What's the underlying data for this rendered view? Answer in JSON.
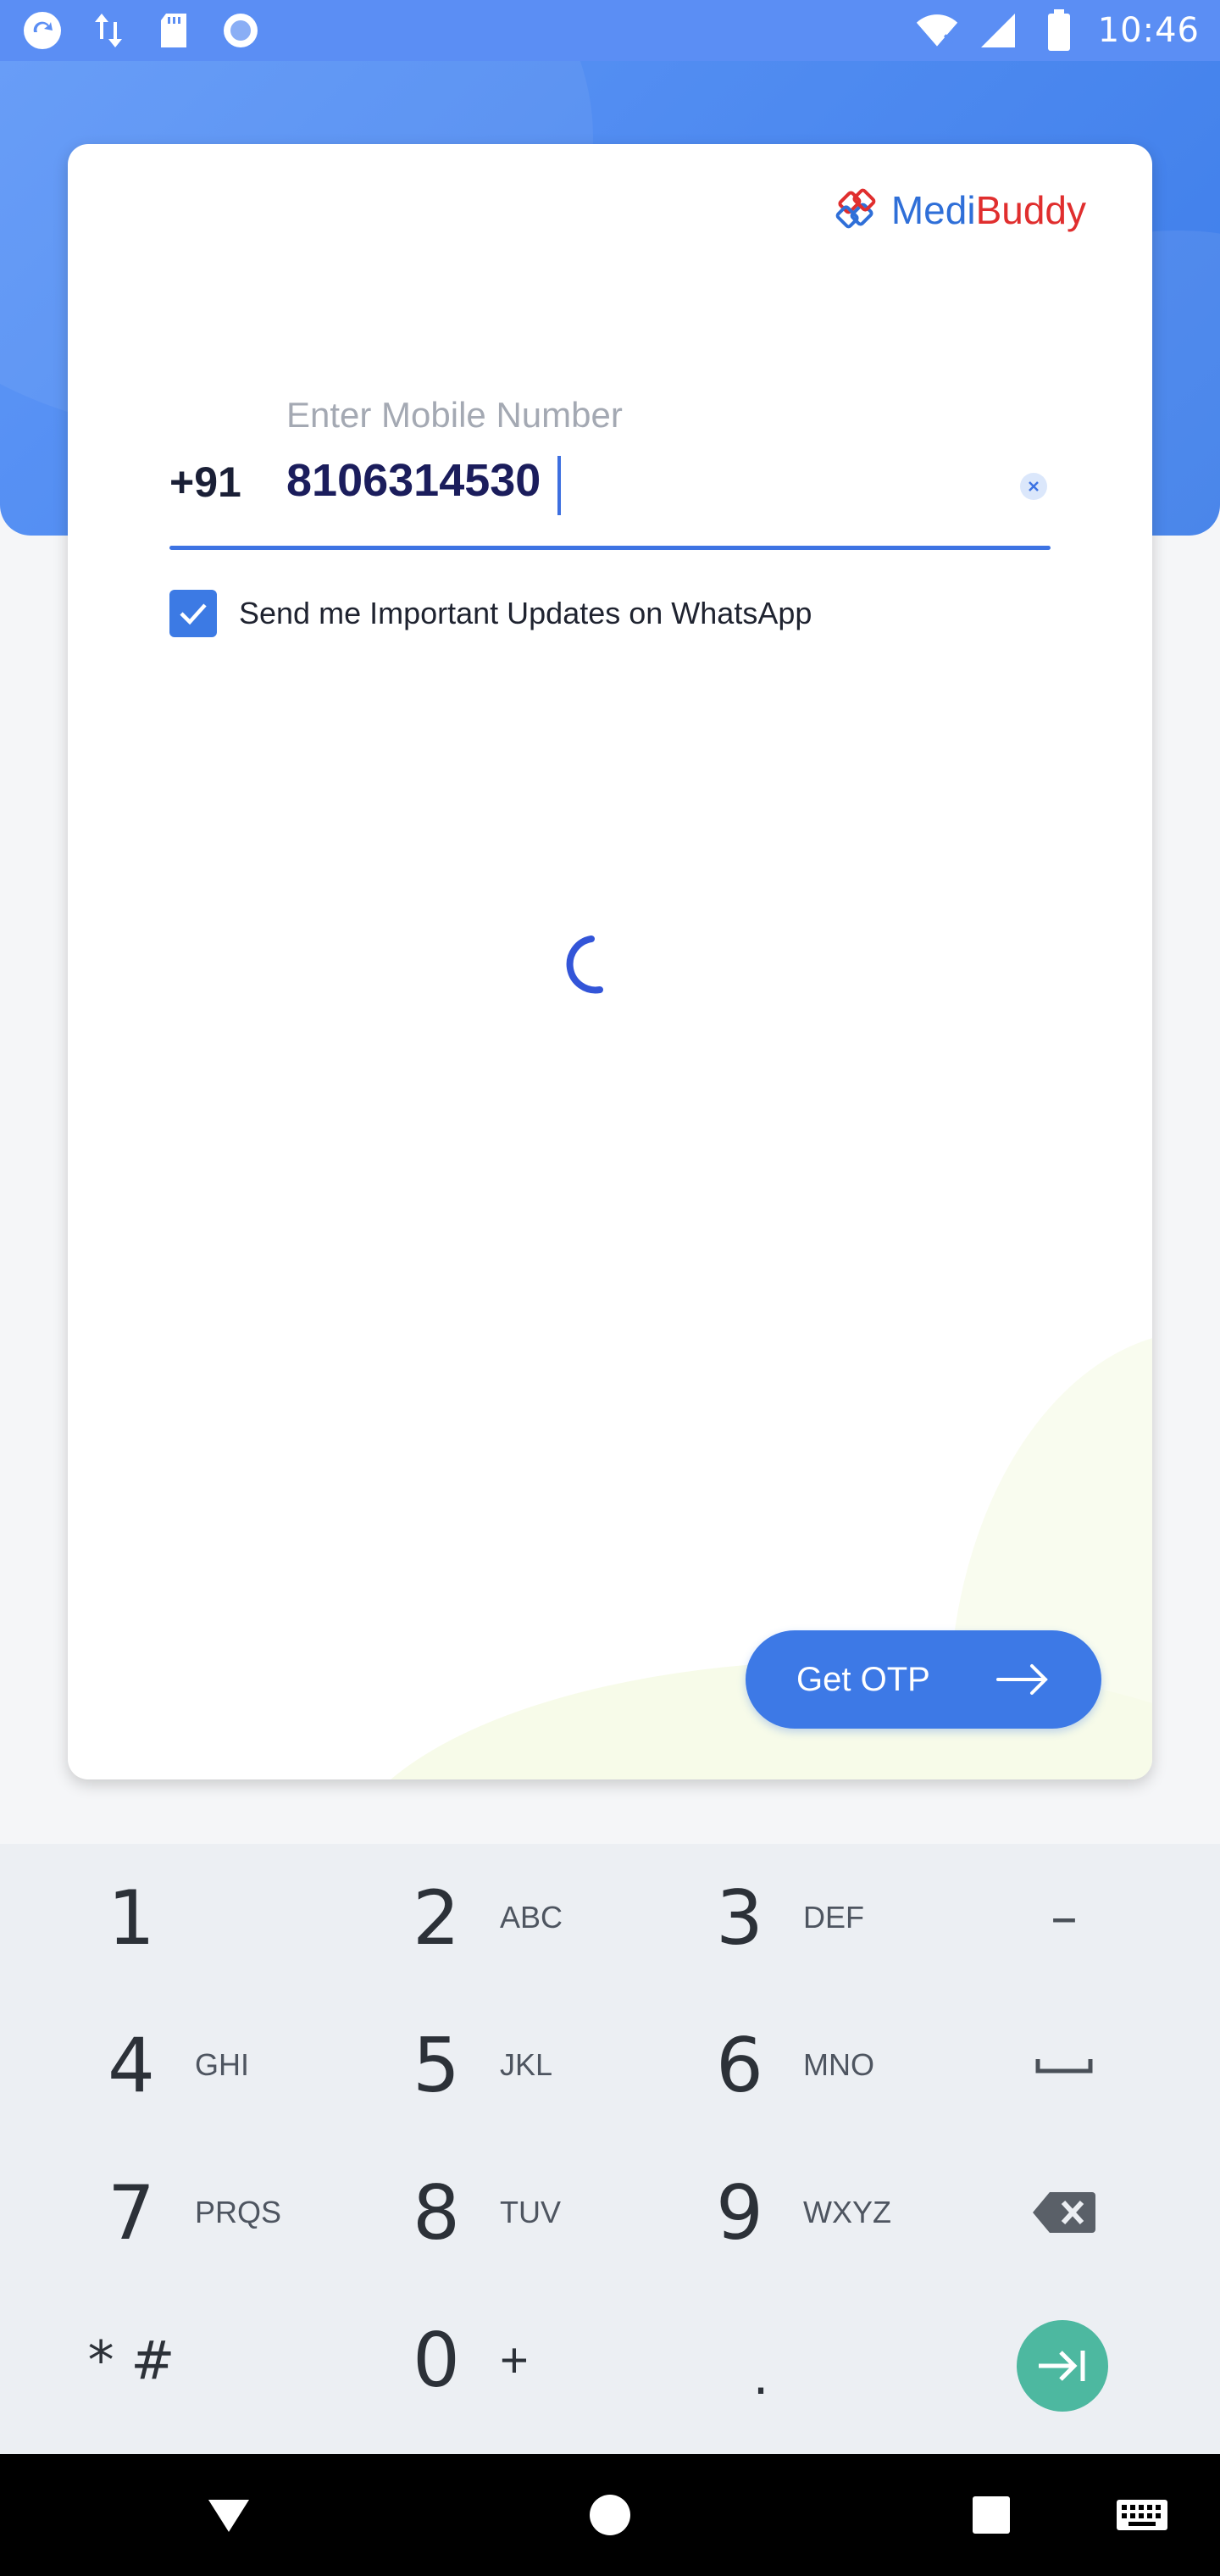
{
  "status_bar": {
    "time": "10:46",
    "icons": [
      "app-sync-icon",
      "data-transfer-icon",
      "sd-card-icon",
      "record-icon",
      "wifi-icon",
      "signal-icon",
      "battery-icon"
    ]
  },
  "brand": {
    "name_part1": "Medi",
    "name_part2": "Buddy",
    "primary_color": "#2f6fd8",
    "accent_color": "#e02e2e"
  },
  "login_form": {
    "field_label": "Enter Mobile Number",
    "country_code": "+91",
    "phone_value": "8106314530",
    "whatsapp_optin_label": "Send me Important Updates on WhatsApp",
    "whatsapp_optin_checked": true,
    "submit_label": "Get OTP",
    "accent_color": "#3d79e6"
  },
  "keypad": {
    "rows": [
      [
        {
          "digit": "1",
          "letters": ""
        },
        {
          "digit": "2",
          "letters": "ABC"
        },
        {
          "digit": "3",
          "letters": "DEF"
        }
      ],
      [
        {
          "digit": "4",
          "letters": "GHI"
        },
        {
          "digit": "5",
          "letters": "JKL"
        },
        {
          "digit": "6",
          "letters": "MNO"
        }
      ],
      [
        {
          "digit": "7",
          "letters": "PRQS"
        },
        {
          "digit": "8",
          "letters": "TUV"
        },
        {
          "digit": "9",
          "letters": "WXYZ"
        }
      ],
      [
        {
          "digit": "* #",
          "letters": ""
        },
        {
          "digit": "0",
          "letters": "+"
        },
        {
          "digit": ".",
          "letters": ""
        }
      ]
    ],
    "side_keys": [
      "minus-key",
      "space-key",
      "backspace-key",
      "next-key"
    ],
    "minus_symbol": "–",
    "next_color": "#4db8a0"
  },
  "nav_bar": {
    "buttons": [
      "back-icon",
      "home-icon",
      "recents-icon",
      "keyboard-icon"
    ]
  }
}
